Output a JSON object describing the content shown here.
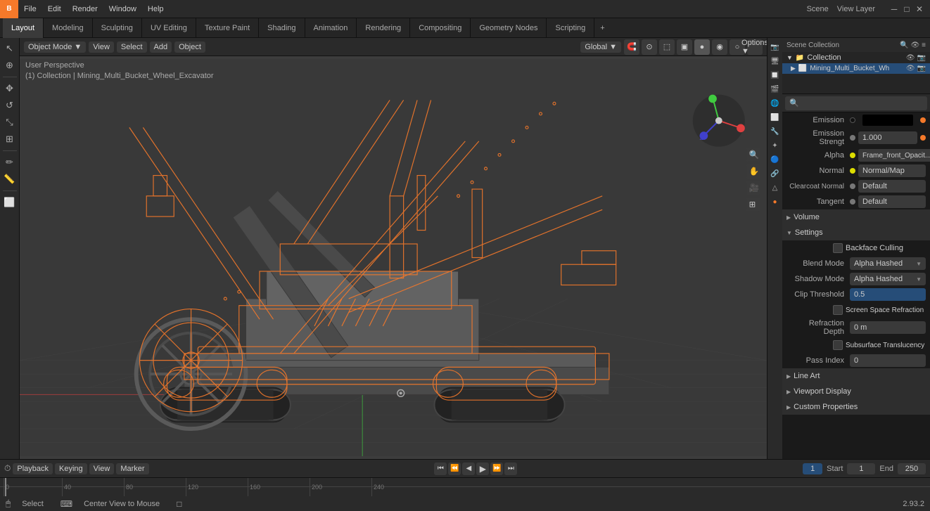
{
  "app": {
    "name": "Blender",
    "version": "2.93.2",
    "scene": "Scene",
    "view_layer": "View Layer"
  },
  "menu": {
    "items": [
      "File",
      "Edit",
      "Render",
      "Window",
      "Help"
    ]
  },
  "workspace_tabs": {
    "tabs": [
      "Layout",
      "Modeling",
      "Sculpting",
      "UV Editing",
      "Texture Paint",
      "Shading",
      "Animation",
      "Rendering",
      "Compositing",
      "Geometry Nodes",
      "Scripting"
    ],
    "active": "Layout",
    "plus": "+"
  },
  "viewport": {
    "mode": "Object Mode",
    "view_label": "View",
    "select_label": "Select",
    "add_label": "Add",
    "object_label": "Object",
    "transform": "Global",
    "info_line1": "User Perspective",
    "info_line2": "(1) Collection | Mining_Multi_Bucket_Wheel_Excavator"
  },
  "toolbar": {
    "buttons": [
      "↖",
      "✥",
      "↔",
      "↺",
      "⊞",
      "✏",
      "✒",
      "✄",
      "⊙"
    ]
  },
  "outliner": {
    "title": "Scene Collection",
    "items": [
      {
        "label": "Collection",
        "level": 1,
        "expanded": true
      },
      {
        "label": "Mining_Multi_Bucket_Wh",
        "level": 2,
        "selected": true
      }
    ]
  },
  "properties": {
    "search_placeholder": "🔍",
    "sections": {
      "surface": {
        "emission": {
          "label": "Emission",
          "color": "#000000"
        },
        "emission_strength": {
          "label": "Emission Strengt",
          "value": "1.000"
        },
        "alpha": {
          "label": "Alpha",
          "value": "Frame_front_Opacit..."
        },
        "normal": {
          "label": "Normal",
          "value": "Normal/Map"
        },
        "clearcoat_normal": {
          "label": "Clearcoat Normal",
          "value": "Default"
        },
        "tangent": {
          "label": "Tangent",
          "value": "Default"
        }
      },
      "volume": {
        "label": "Volume"
      },
      "settings": {
        "label": "Settings",
        "backface_culling": "Backface Culling",
        "blend_mode": {
          "label": "Blend Mode",
          "value": "Alpha Hashed"
        },
        "shadow_mode": {
          "label": "Shadow Mode",
          "value": "Alpha Hashed"
        },
        "clip_threshold": {
          "label": "Clip Threshold",
          "value": "0.5"
        },
        "screen_space_refraction": "Screen Space Refraction",
        "refraction_depth": {
          "label": "Refraction Depth",
          "value": "0 m"
        },
        "subsurface_translucency": "Subsurface Translucency",
        "pass_index": {
          "label": "Pass Index",
          "value": "0"
        }
      },
      "line_art": {
        "label": "Line Art"
      },
      "viewport_display": {
        "label": "Viewport Display"
      },
      "custom_properties": {
        "label": "Custom Properties"
      }
    }
  },
  "timeline": {
    "playback": "Playback",
    "keying": "Keying",
    "view": "View",
    "marker": "Marker",
    "frame": "1",
    "start_label": "Start",
    "start_value": "1",
    "end_label": "End",
    "end_value": "250",
    "ruler_marks": [
      "0",
      "40",
      "80",
      "120",
      "160",
      "200",
      "240"
    ]
  },
  "status": {
    "select": "Select",
    "center_view": "Center View to Mouse",
    "version": "2.93.2"
  }
}
